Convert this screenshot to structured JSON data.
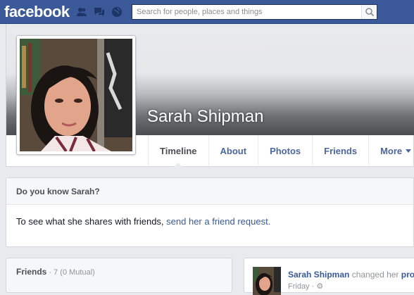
{
  "topbar": {
    "logo": "facebook",
    "search_placeholder": "Search for people, places and things"
  },
  "profile": {
    "name": "Sarah Shipman"
  },
  "tabs": [
    {
      "label": "Timeline"
    },
    {
      "label": "About"
    },
    {
      "label": "Photos"
    },
    {
      "label": "Friends"
    },
    {
      "label": "More"
    }
  ],
  "know": {
    "title": "Do you know Sarah?",
    "text": "To see what she shares with friends, ",
    "link": "send her a friend request."
  },
  "friends": {
    "title": "Friends",
    "count": " · 7 (0 Mutual)"
  },
  "story": {
    "name": "Sarah Shipman",
    "action": " changed her ",
    "action_link": "pro",
    "time": "Friday · "
  },
  "colors": {
    "brand_blue": "#3b5998",
    "link_blue": "#4b67a1",
    "page_bg": "#e9eaed"
  }
}
